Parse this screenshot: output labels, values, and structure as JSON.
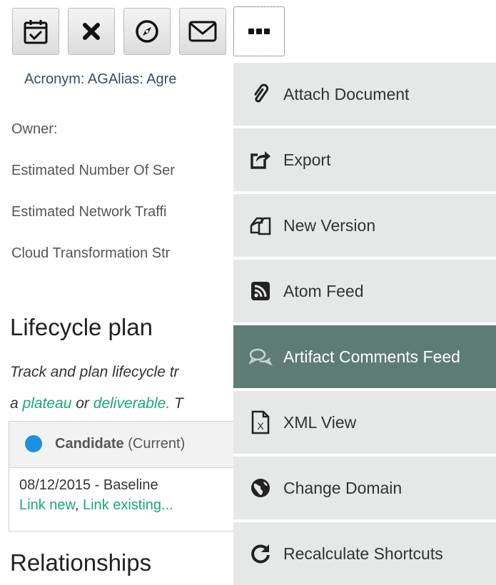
{
  "toolbar": {
    "buttons": [
      {
        "name": "calendar-check-button",
        "icon": "calendar-check-icon"
      },
      {
        "name": "close-button",
        "icon": "close-icon"
      },
      {
        "name": "compass-button",
        "icon": "compass-icon"
      },
      {
        "name": "email-button",
        "icon": "envelope-icon"
      },
      {
        "name": "more-actions-button",
        "icon": "ellipsis-icon"
      }
    ]
  },
  "details": {
    "acronym": "Acronym: AGAlias: Agre",
    "owner": "Owner:",
    "servers": "Estimated Number Of Ser",
    "traffic": "Estimated Network Traffi",
    "cloud": "Cloud Transformation Str"
  },
  "lifecycle": {
    "heading": "Lifecycle plan",
    "desc_line1": "Track and plan lifecycle tr",
    "desc_a": "a ",
    "desc_plateau": "plateau",
    "desc_or": " or ",
    "desc_deliverable": "deliverable.",
    "desc_tail": " T",
    "candidate_label": "Candidate",
    "candidate_state": " (Current)",
    "date_row": "08/12/2015 - Baseline",
    "link_new": "Link new",
    "link_sep": ", ",
    "link_existing": "Link existing..."
  },
  "relationships": {
    "heading": "Relationships"
  },
  "menu": {
    "items": [
      {
        "label": "Attach Document",
        "icon": "paperclip-icon"
      },
      {
        "label": "Export",
        "icon": "export-icon"
      },
      {
        "label": "New Version",
        "icon": "copy-versions-icon"
      },
      {
        "label": "Atom Feed",
        "icon": "rss-icon"
      },
      {
        "label": "Artifact Comments Feed",
        "icon": "comments-icon"
      },
      {
        "label": "XML View",
        "icon": "xml-file-icon"
      },
      {
        "label": "Change Domain",
        "icon": "globe-icon"
      },
      {
        "label": "Recalculate Shortcuts",
        "icon": "refresh-icon"
      }
    ],
    "highlighted_index": 4
  },
  "colors": {
    "link": "#18a779",
    "menu_bg": "#e6e7e7",
    "menu_hover": "#5f7c74",
    "status_dot": "#1e90e0"
  }
}
